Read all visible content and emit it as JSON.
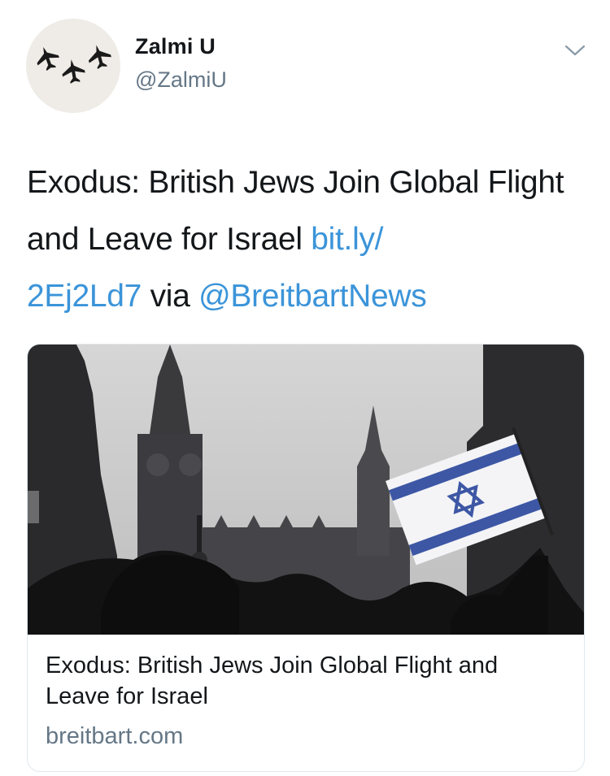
{
  "user": {
    "display_name": "Zalmi U",
    "handle": "@ZalmiU",
    "avatar_icon": "jets-formation-icon"
  },
  "tweet": {
    "text_plain": "Exodus: British Jews Join Global Flight and Leave for Israel",
    "link_part1": "bit.ly/",
    "link_part2": "2Ej2Ld7",
    "via": "via",
    "mention": "@BreitbartNews"
  },
  "card": {
    "title": "Exodus: British Jews Join Global Flight and Leave for Israel",
    "domain": "breitbart.com",
    "image_icon": "israeli-flag-big-ben-photo"
  },
  "colors": {
    "link": "#3b94d9",
    "muted": "#657786",
    "text": "#14171a",
    "border": "#e1e8ed"
  }
}
